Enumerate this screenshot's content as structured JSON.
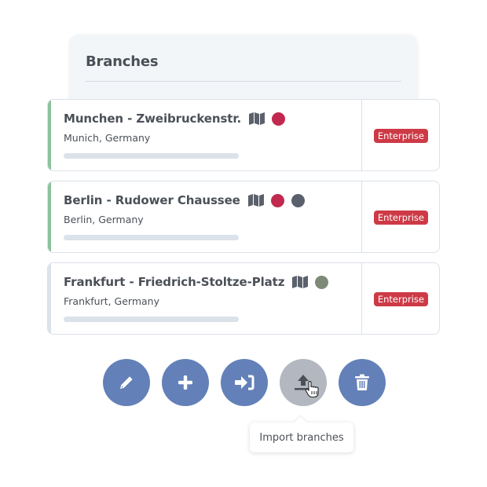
{
  "panel": {
    "title": "Branches"
  },
  "branches": [
    {
      "name": "Munchen - Zweibruckenstr.",
      "location": "Munich, Germany",
      "badge": "Enterprise",
      "accent_color": "#8cc29c",
      "status_dots": [
        "#c1294e"
      ]
    },
    {
      "name": "Berlin - Rudower Chaussee",
      "location": "Berlin, Germany",
      "badge": "Enterprise",
      "accent_color": "#8cc29c",
      "status_dots": [
        "#c1294e",
        "#5b616c"
      ]
    },
    {
      "name": "Frankfurt - Friedrich-Stoltze-Platz",
      "location": "Frankfurt, Germany",
      "badge": "Enterprise",
      "accent_color": "#dbe2ea",
      "status_dots": [
        "#7e8a78"
      ]
    }
  ],
  "actions": [
    {
      "id": "edit",
      "icon": "pencil-icon",
      "label": "Edit branch"
    },
    {
      "id": "add",
      "icon": "plus-icon",
      "label": "Add branch"
    },
    {
      "id": "signin",
      "icon": "sign-in-icon",
      "label": "Enter branch"
    },
    {
      "id": "import",
      "icon": "upload-icon",
      "label": "Import branches",
      "hovered": true
    },
    {
      "id": "delete",
      "icon": "trash-icon",
      "label": "Delete branch"
    }
  ],
  "tooltip": {
    "text": "Import branches"
  },
  "colors": {
    "primary": "#6381b8",
    "hover": "#b2b7c0",
    "badge": "#cd3a46"
  }
}
